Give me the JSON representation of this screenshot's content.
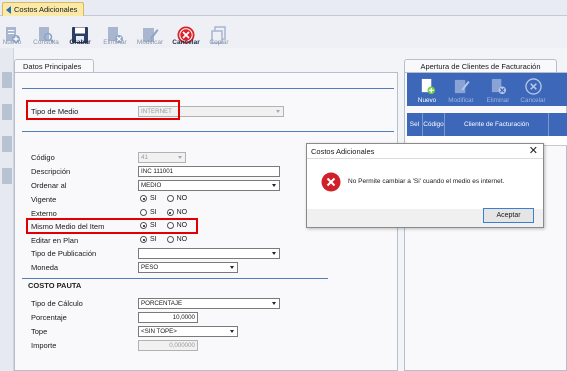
{
  "window": {
    "tab_title": "Costos Adicionales"
  },
  "toolbar": {
    "nuevo": "Nuevo",
    "consulta": "Consulta",
    "grabar": "Grabar",
    "eliminar": "Eliminar",
    "modificar": "Modificar",
    "cancelar": "Cancelar",
    "copiar": "Copiar"
  },
  "main": {
    "tab_label": "Datos Principales",
    "tipo_medio_label": "Tipo de Medio",
    "tipo_medio_value": "INTERNET",
    "codigo_label": "Código",
    "codigo_value": "41",
    "descripcion_label": "Descripción",
    "descripcion_value": "INC 111001",
    "ordenar_label": "Ordenar al",
    "ordenar_value": "MEDIO",
    "vigente_label": "Vigente",
    "externo_label": "Externo",
    "mismo_medio_label": "Mismo Medio del Item",
    "editar_label": "Editar en Plan",
    "tipo_publicacion_label": "Tipo de Publicación",
    "tipo_publicacion_value": "",
    "moneda_label": "Moneda",
    "moneda_value": "PESO",
    "si": "SI",
    "no": "NO",
    "radios": {
      "vigente": "SI",
      "externo": "NO",
      "mismo_medio": "SI",
      "editar": "SI"
    },
    "costo_pauta_title": "COSTO PAUTA",
    "tipo_calculo_label": "Tipo de Cálculo",
    "tipo_calculo_value": "PORCENTAJE",
    "porcentaje_label": "Porcentaje",
    "porcentaje_value": "10,0000",
    "tope_label": "Tope",
    "tope_value": "<SIN TOPE>",
    "importe_label": "Importe",
    "importe_value": "0,000000"
  },
  "right_panel": {
    "tab_label": "Apertura de Clientes de Facturación",
    "nuevo": "Nuevo",
    "modificar": "Modificar",
    "eliminar": "Eliminar",
    "cancelar": "Cancelar",
    "columns": [
      "Sel",
      "Código",
      "Cliente de Facturación"
    ]
  },
  "dialog": {
    "title": "Costos Adicionales",
    "close": "✕",
    "message": "No Permite cambiar a 'Si' cuando el medio es internet.",
    "ok_label": "Aceptar"
  },
  "colors": {
    "accent_blue": "#3d67b9",
    "highlight_red": "#e00000",
    "error_red": "#d0202a"
  }
}
